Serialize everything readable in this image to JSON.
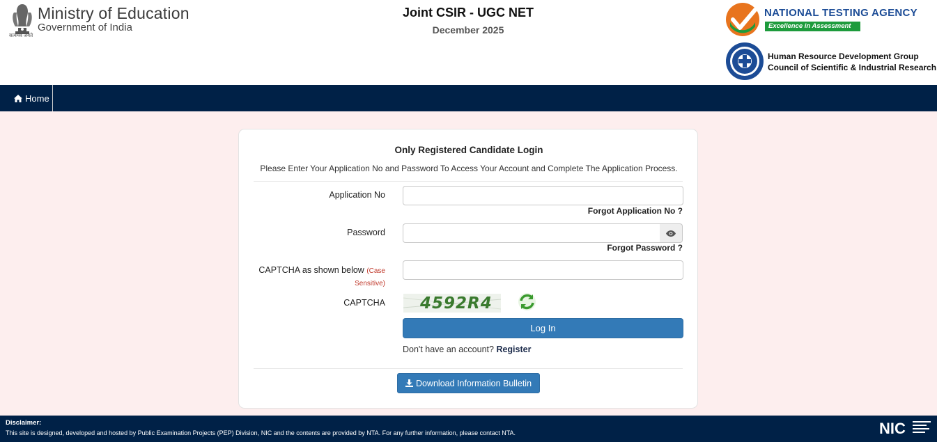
{
  "header": {
    "ministry_title": "Ministry of Education",
    "ministry_subtitle": "Government of India",
    "motto": "सत्यमेव जयते",
    "exam_title": "Joint CSIR - UGC NET",
    "exam_session": "December 2025",
    "nta_name": "NATIONAL TESTING AGENCY",
    "nta_tagline": "Excellence in Assessment",
    "csir_line1": "Human Resource Development Group",
    "csir_line2": "Council of Scientific & Industrial Research"
  },
  "nav": {
    "home_label": "Home",
    "home_icon": "home-icon"
  },
  "login": {
    "title": "Only Registered Candidate Login",
    "subtitle": "Please Enter Your Application No and Password To Access Your Account and Complete The Application Process.",
    "application_label": "Application No",
    "application_value": "",
    "forgot_application": "Forgot Application No ?",
    "password_label": "Password",
    "password_value": "",
    "forgot_password": "Forgot Password ?",
    "captcha_input_label": "CAPTCHA as shown below",
    "captcha_case_note": "(Case Sensitive)",
    "captcha_value": "",
    "captcha_label": "CAPTCHA",
    "captcha_text": "4592R4",
    "login_button": "Log In",
    "no_account_text": "Don't have an account?",
    "register_link": "Register",
    "download_button": "Download Information Bulletin"
  },
  "footer": {
    "disclaimer_title": "Disclaimer:",
    "disclaimer_text": "This site is designed, developed and hosted by Public Examination Projects (PEP) Division, NIC and the contents are provided by NTA. For any further information, please contact NTA.",
    "nic_label": "NIC"
  },
  "colors": {
    "navbar": "#002147",
    "button": "#337ab7",
    "page_bg": "#fdeeee",
    "nta_blue": "#1c4c96",
    "nta_green": "#1d9b3c"
  }
}
